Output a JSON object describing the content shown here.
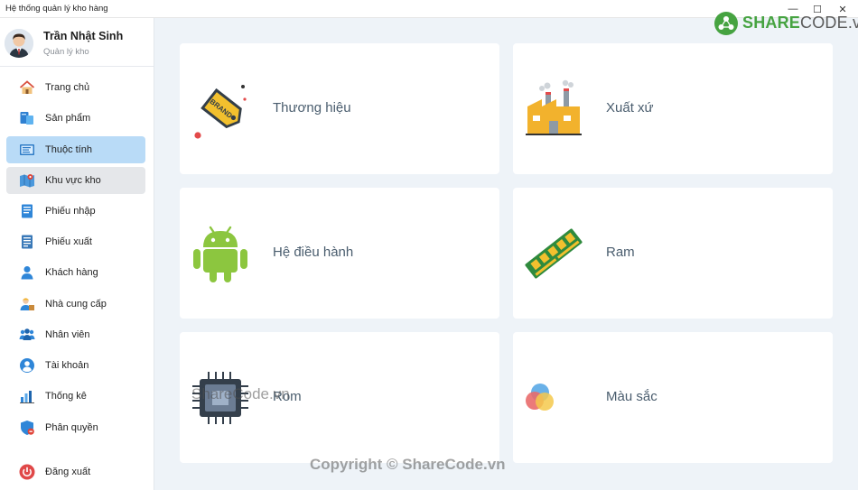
{
  "window": {
    "title": "Hệ thống quản lý kho hàng",
    "minimize": "—",
    "maximize": "☐",
    "close": "✕"
  },
  "user": {
    "name": "Trần Nhật Sinh",
    "role": "Quản lý kho"
  },
  "menu": [
    {
      "label": "Trang chủ",
      "icon": "home-icon"
    },
    {
      "label": "Sản phẩm",
      "icon": "product-icon"
    },
    {
      "label": "Thuộc tính",
      "icon": "attribute-icon",
      "state": "active"
    },
    {
      "label": "Khu vực kho",
      "icon": "warehouse-map-icon",
      "state": "hover"
    },
    {
      "label": "Phiếu nhập",
      "icon": "import-slip-icon"
    },
    {
      "label": "Phiếu xuất",
      "icon": "export-slip-icon"
    },
    {
      "label": "Khách hàng",
      "icon": "customer-icon"
    },
    {
      "label": "Nhà cung cấp",
      "icon": "supplier-icon"
    },
    {
      "label": "Nhân viên",
      "icon": "staff-icon"
    },
    {
      "label": "Tài khoản",
      "icon": "account-icon"
    },
    {
      "label": "Thống kê",
      "icon": "statistics-icon"
    },
    {
      "label": "Phân quyền",
      "icon": "permission-shield-icon"
    }
  ],
  "logout": {
    "label": "Đăng xuất",
    "icon": "power-icon"
  },
  "cards": [
    {
      "label": "Thương hiệu",
      "icon": "brand-tag-icon",
      "icon_text": "BRAND"
    },
    {
      "label": "Xuất xứ",
      "icon": "factory-icon"
    },
    {
      "label": "Hệ điều hành",
      "icon": "android-icon"
    },
    {
      "label": "Ram",
      "icon": "ram-stick-icon"
    },
    {
      "label": "Rom",
      "icon": "chip-icon"
    },
    {
      "label": "Màu sắc",
      "icon": "color-circles-icon"
    }
  ],
  "watermarks": {
    "logo_main": "SHARE",
    "logo_tail": "CODE.vn",
    "center": "ShareCode.vn",
    "bottom": "Copyright © ShareCode.vn"
  },
  "colors": {
    "active_menu": "#b9dbf7",
    "hover_menu": "#e5e7ea",
    "content_bg": "#eef3f8",
    "card_label": "#4a5d6e"
  }
}
